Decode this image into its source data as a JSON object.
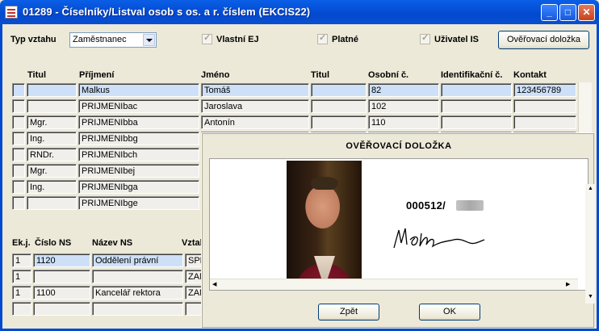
{
  "window": {
    "title": "01289 - Číselníky/Listval osob s os. a r. číslem (EKCIS22)",
    "minimize_label": "_",
    "maximize_label": "□",
    "close_label": "✕"
  },
  "filters": {
    "typ_vztahu_label": "Typ vztahu",
    "typ_vztahu_value": "Zaměstnanec",
    "vlastni_ej_label": "Vlastní EJ",
    "platne_label": "Platné",
    "uzivatel_is_label": "Uživatel IS",
    "overovaci_button": "Ověřovací doložka"
  },
  "persons_table": {
    "headers": {
      "titul1": "Titul",
      "prijmeni": "Příjmení",
      "jmeno": "Jméno",
      "titul2": "Titul",
      "osobni": "Osobní č.",
      "identifikacni": "Identifikační č.",
      "kontakt": "Kontakt"
    },
    "rows": [
      {
        "titul": "",
        "prijmeni": "Malkus",
        "jmeno": "Tomáš",
        "titul2": "",
        "osobni": "82",
        "ident": "",
        "kontakt": "123456789"
      },
      {
        "titul": "",
        "prijmeni": "PRIJMENIbac",
        "jmeno": "Jaroslava",
        "titul2": "",
        "osobni": "102",
        "ident": "",
        "kontakt": ""
      },
      {
        "titul": "Mgr.",
        "prijmeni": "PRIJMENIbba",
        "jmeno": "Antonín",
        "titul2": "",
        "osobni": "110",
        "ident": "",
        "kontakt": ""
      },
      {
        "titul": "Ing.",
        "prijmeni": "PRIJMENIbbg",
        "jmeno": "",
        "titul2": "",
        "osobni": "",
        "ident": "",
        "kontakt": ""
      },
      {
        "titul": "RNDr.",
        "prijmeni": "PRIJMENIbch",
        "jmeno": "",
        "titul2": "",
        "osobni": "",
        "ident": "",
        "kontakt": ""
      },
      {
        "titul": "Mgr.",
        "prijmeni": "PRIJMENIbej",
        "jmeno": "",
        "titul2": "",
        "osobni": "",
        "ident": "",
        "kontakt": ""
      },
      {
        "titul": "Ing.",
        "prijmeni": "PRIJMENIbga",
        "jmeno": "",
        "titul2": "",
        "osobni": "",
        "ident": "",
        "kontakt": ""
      },
      {
        "titul": "",
        "prijmeni": "PRIJMENIbge",
        "jmeno": "",
        "titul2": "",
        "osobni": "",
        "ident": "",
        "kontakt": ""
      }
    ]
  },
  "ns_table": {
    "headers": {
      "ekj": "Ek.j.",
      "cislo": "Číslo NS",
      "nazev": "Název NS",
      "vztah": "Vztal"
    },
    "rows": [
      {
        "ekj": "1",
        "cislo": "1120",
        "nazev": "Oddělení právní",
        "vztah": "SPR"
      },
      {
        "ekj": "1",
        "cislo": "",
        "nazev": "",
        "vztah": "ZAM"
      },
      {
        "ekj": "1",
        "cislo": "1100",
        "nazev": "Kancelář rektora",
        "vztah": "ZAM"
      },
      {
        "ekj": "",
        "cislo": "",
        "nazev": "",
        "vztah": ""
      }
    ]
  },
  "dialog": {
    "title": "OVĚŘOVACÍ DOLOŽKA",
    "document_number": "000512/",
    "back_button": "Zpět",
    "ok_button": "OK"
  }
}
